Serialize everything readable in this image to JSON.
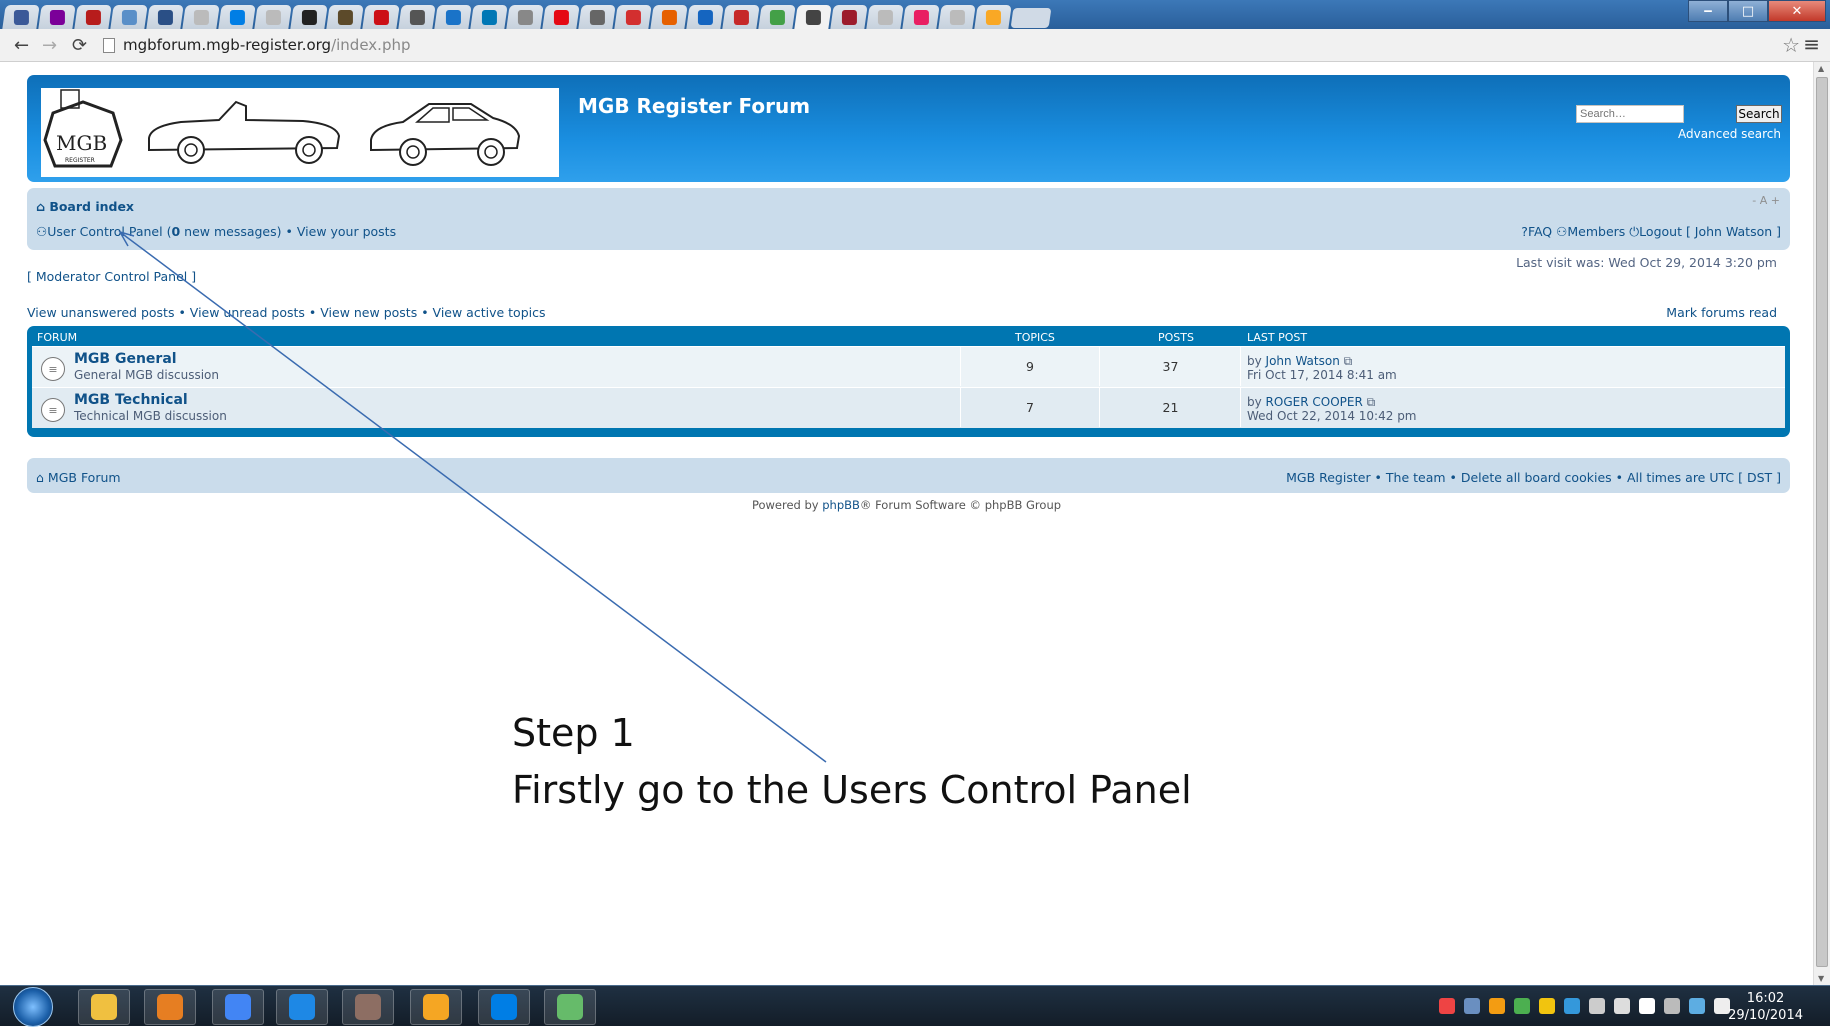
{
  "browser": {
    "tab_icons": [
      "facebook-icon",
      "yahoo-icon",
      "photo-icon",
      "mail-icon",
      "monitor-icon",
      "page-icon",
      "dropbox-icon",
      "page-icon",
      "amazon-icon",
      "bag-icon",
      "opera-icon",
      "chat-icon",
      "sync-icon",
      "linkedin-icon",
      "globe-icon",
      "netflix-icon",
      "image-icon",
      "star-icon",
      "mozilla-icon",
      "card-icon",
      "paypal-icon",
      "shield-icon",
      "mgb-icon",
      "photo-icon",
      "page-icon",
      "tumblr-icon",
      "page-icon",
      "coin-icon"
    ],
    "tab_colors": [
      "#3b5998",
      "#7b0099",
      "#b71c1c",
      "#5a8fc8",
      "#2a4f86",
      "#bbbbbb",
      "#007ee5",
      "#bbbbbb",
      "#222222",
      "#5c4a2a",
      "#cc0f16",
      "#555555",
      "#1a73c8",
      "#0077b5",
      "#888888",
      "#e50914",
      "#666666",
      "#d32f2f",
      "#e66000",
      "#1565c0",
      "#c62828",
      "#43a047",
      "#444444",
      "#9c1c2c",
      "#bbbbbb",
      "#e91e63",
      "#bbbbbb",
      "#f9a825"
    ],
    "address": {
      "domain": "mgbforum.mgb-register.org",
      "path": "/index.php"
    }
  },
  "header": {
    "site_title": "MGB Register Forum",
    "search_placeholder": "Search…",
    "search_button": "Search",
    "advanced_search": "Advanced search",
    "logo_text": "MGB",
    "logo_sub": "REGISTER"
  },
  "navbar": {
    "board_index": "Board index",
    "font_size": "- A +",
    "ucp_link": "User Control Panel",
    "new_messages_prefix": "(",
    "new_messages_count": "0",
    "new_messages_suffix": "new messages)",
    "bullet": "•",
    "view_posts": "View your posts",
    "faq": "FAQ",
    "members": "Members",
    "logout": "Logout [ John Watson ]"
  },
  "last_visit": "Last visit was: Wed Oct 29, 2014 3:20 pm",
  "moderator_cp": "[ Moderator Control Panel ]",
  "view_links": {
    "unanswered": "View unanswered posts",
    "unread": "View unread posts",
    "new": "View new posts",
    "active": "View active topics"
  },
  "mark_read": "Mark forums read",
  "forum_table": {
    "headers": {
      "forum": "FORUM",
      "topics": "TOPICS",
      "posts": "POSTS",
      "last_post": "LAST POST"
    },
    "rows": [
      {
        "name": "MGB General",
        "desc": "General MGB discussion",
        "topics": "9",
        "posts": "37",
        "by": "by",
        "author": "John Watson",
        "date": "Fri Oct 17, 2014 8:41 am"
      },
      {
        "name": "MGB Technical",
        "desc": "Technical MGB discussion",
        "topics": "7",
        "posts": "21",
        "by": "by",
        "author": "ROGER COOPER",
        "date": "Wed Oct 22, 2014 10:42 pm"
      }
    ]
  },
  "footer": {
    "home": "MGB Forum",
    "links": "MGB Register • The team • Delete all board cookies • All times are UTC [ DST ]",
    "powered_prefix": "Powered by ",
    "powered_link": "phpBB",
    "powered_suffix": "® Forum Software © phpBB Group"
  },
  "annotation": {
    "line1": "Step 1",
    "line2": "Firstly go to the Users Control Panel",
    "arrow_color": "#3a6bb0"
  },
  "taskbar": {
    "apps": [
      "explorer-icon",
      "media-player-icon",
      "chrome-icon",
      "ie-icon",
      "pet-icon",
      "outlook-icon",
      "dropbox-icon",
      "maps-icon"
    ],
    "time": "16:02",
    "date": "29/10/2014"
  }
}
